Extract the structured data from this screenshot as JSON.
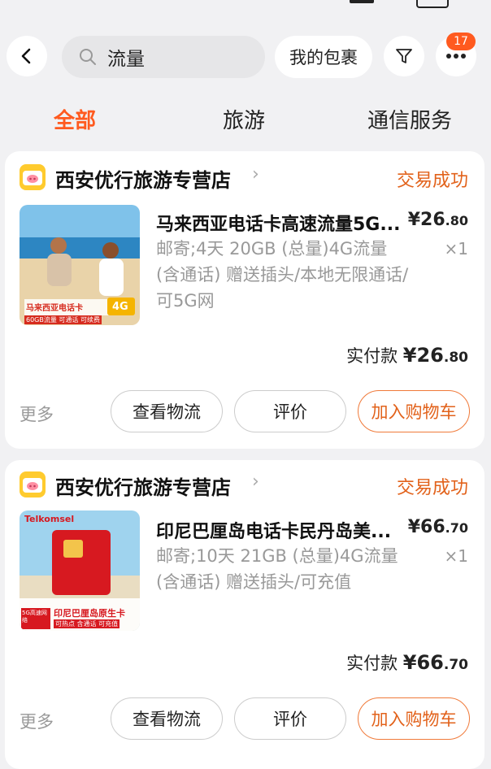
{
  "topbar": {
    "search_text": "流量",
    "parcel_label": "我的包裹",
    "badge_count": "17"
  },
  "tabs": [
    {
      "label": "全部",
      "active": true
    },
    {
      "label": "旅游",
      "active": false
    },
    {
      "label": "通信服务",
      "active": false
    }
  ],
  "orders": [
    {
      "shop": "西安优行旅游专营店",
      "status": "交易成功",
      "title": "马来西亚电话卡高速流量5G...",
      "price_main": "¥26",
      "price_dec": ".80",
      "desc": "邮寄;4天 20GB (总量)4G流量 (含通话) 赠送插头/本地无限通话/可5G网",
      "qty": "×1",
      "paid_label": "实付款",
      "paid_main": "¥26",
      "paid_dec": ".80",
      "thumb_caption": "马来西亚电话卡",
      "thumb_badge": "4G",
      "thumb_sub": "60GB流量 可通话 可续费",
      "more": "更多",
      "btn_logistics": "查看物流",
      "btn_review": "评价",
      "btn_cart": "加入购物车"
    },
    {
      "shop": "西安优行旅游专营店",
      "status": "交易成功",
      "title": "印尼巴厘岛电话卡民丹岛美...",
      "price_main": "¥66",
      "price_dec": ".70",
      "desc": "邮寄;10天 21GB (总量)4G流量 (含通话) 赠送插头/可充值",
      "qty": "×1",
      "paid_label": "实付款",
      "paid_main": "¥66",
      "paid_dec": ".70",
      "thumb_brand": "Telkomsel",
      "thumb_caption": "印尼巴厘岛原生卡",
      "thumb_sub": "可热点 含通话 可充值",
      "thumb_tag": "5G高速网络",
      "more": "更多",
      "btn_logistics": "查看物流",
      "btn_review": "评价",
      "btn_cart": "加入购物车"
    }
  ],
  "colors": {
    "accent": "#ff5a1f",
    "status": "#e2621b",
    "background": "#f1f1f3"
  }
}
